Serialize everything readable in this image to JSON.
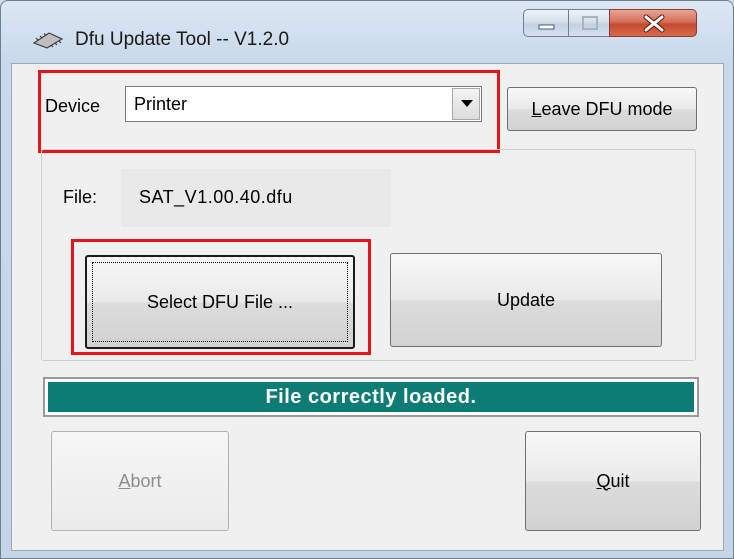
{
  "window": {
    "title": "Dfu Update Tool -- V1.2.0",
    "icon": "chip-icon"
  },
  "caption_buttons": {
    "minimize_icon": "minimize-icon",
    "maximize_icon": "maximize-icon",
    "close_icon": "close-icon"
  },
  "device": {
    "label": "Device",
    "selected": "Printer"
  },
  "leave_dfu": {
    "mnemonic": "L",
    "rest": "eave DFU mode"
  },
  "file": {
    "label": "File:",
    "value": "SAT_V1.00.40.dfu"
  },
  "buttons": {
    "select_file": "Select DFU File ...",
    "update": "Update",
    "abort_mnemonic": "A",
    "abort_rest": "bort",
    "quit_mnemonic": "Q",
    "quit_rest": "uit"
  },
  "status": {
    "text": "File correctly loaded."
  },
  "colors": {
    "status_bg": "#0d7c74",
    "highlight": "#e8141b"
  }
}
